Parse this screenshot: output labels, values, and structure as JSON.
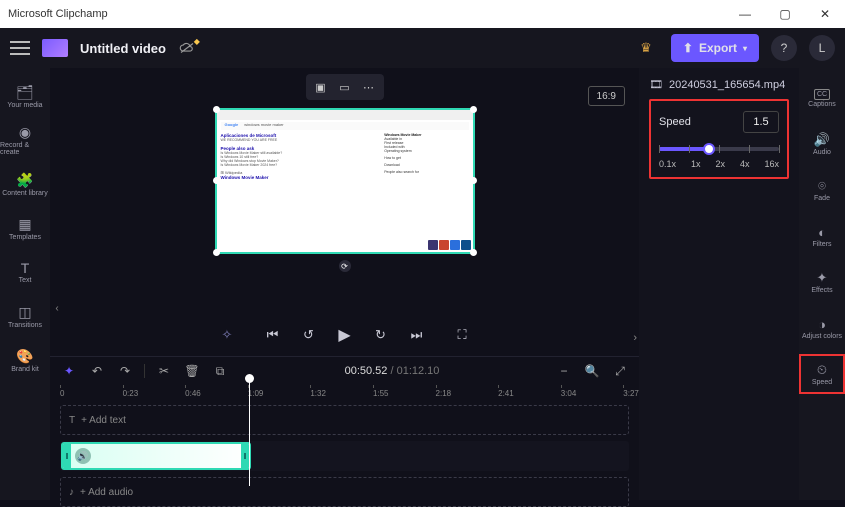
{
  "titlebar": {
    "app": "Microsoft Clipchamp"
  },
  "topbar": {
    "title": "Untitled video",
    "export": "Export",
    "avatar": "L"
  },
  "leftnav": [
    {
      "icon": "🗂",
      "label": "Your media"
    },
    {
      "icon": "◉",
      "label": "Record & create"
    },
    {
      "icon": "🧩",
      "label": "Content library"
    },
    {
      "icon": "▦",
      "label": "Templates"
    },
    {
      "icon": "T",
      "label": "Text"
    },
    {
      "icon": "◫",
      "label": "Transitions"
    },
    {
      "icon": "🎨",
      "label": "Brand kit"
    }
  ],
  "stage": {
    "aspect": "16:9",
    "preview": {
      "search_engine": "Google",
      "query": "windows movie maker",
      "section_apps": "Aplicaciones de Microsoft",
      "section_paa": "People also ask",
      "paa_items": [
        "Is Windows Movie Maker still available?",
        "Is Windows 10 still free?",
        "Why did Windows stop Movie Maker?",
        "Is Windows Movie Maker 2024 free?"
      ],
      "result_title": "Windows Movie Maker",
      "right_title": "Windows Movie Maker",
      "right_fields": [
        "Available in",
        "First release",
        "Included with",
        "Operating system",
        "How to get",
        "Download",
        "People also search for"
      ],
      "thumbs": [
        "#3b3570",
        "#c9452e",
        "#2b6fdc",
        "#0d4f8b"
      ]
    }
  },
  "transport": {
    "current": "00:50.52",
    "duration": "01:12.10"
  },
  "ruler": [
    {
      "pos": 0,
      "label": "0"
    },
    {
      "pos": 11,
      "label": "0:23"
    },
    {
      "pos": 22,
      "label": "0:46"
    },
    {
      "pos": 33,
      "label": "1:09"
    },
    {
      "pos": 44,
      "label": "1:32"
    },
    {
      "pos": 55,
      "label": "1:55"
    },
    {
      "pos": 66,
      "label": "2:18"
    },
    {
      "pos": 77,
      "label": "2:41"
    },
    {
      "pos": 88,
      "label": "3:04"
    },
    {
      "pos": 99,
      "label": "3:27"
    }
  ],
  "tracks": {
    "text_placeholder": "+ Add text",
    "audio_placeholder": "+ Add audio"
  },
  "rightpanel": {
    "filename": "20240531_165654.mp4",
    "speed_label": "Speed",
    "speed_value": "1.5",
    "slider_fill_pct": 42,
    "ticks": [
      0,
      25,
      50,
      75,
      100
    ],
    "labels": [
      "0.1x",
      "1x",
      "2x",
      "4x",
      "16x"
    ]
  },
  "rightnav": [
    {
      "icon": "CC",
      "label": "Captions"
    },
    {
      "icon": "🔊",
      "label": "Audio"
    },
    {
      "icon": "⌾",
      "label": "Fade"
    },
    {
      "icon": "◐",
      "label": "Filters"
    },
    {
      "icon": "✦",
      "label": "Effects"
    },
    {
      "icon": "◑",
      "label": "Adjust colors"
    },
    {
      "icon": "⏲",
      "label": "Speed",
      "active": true
    }
  ]
}
